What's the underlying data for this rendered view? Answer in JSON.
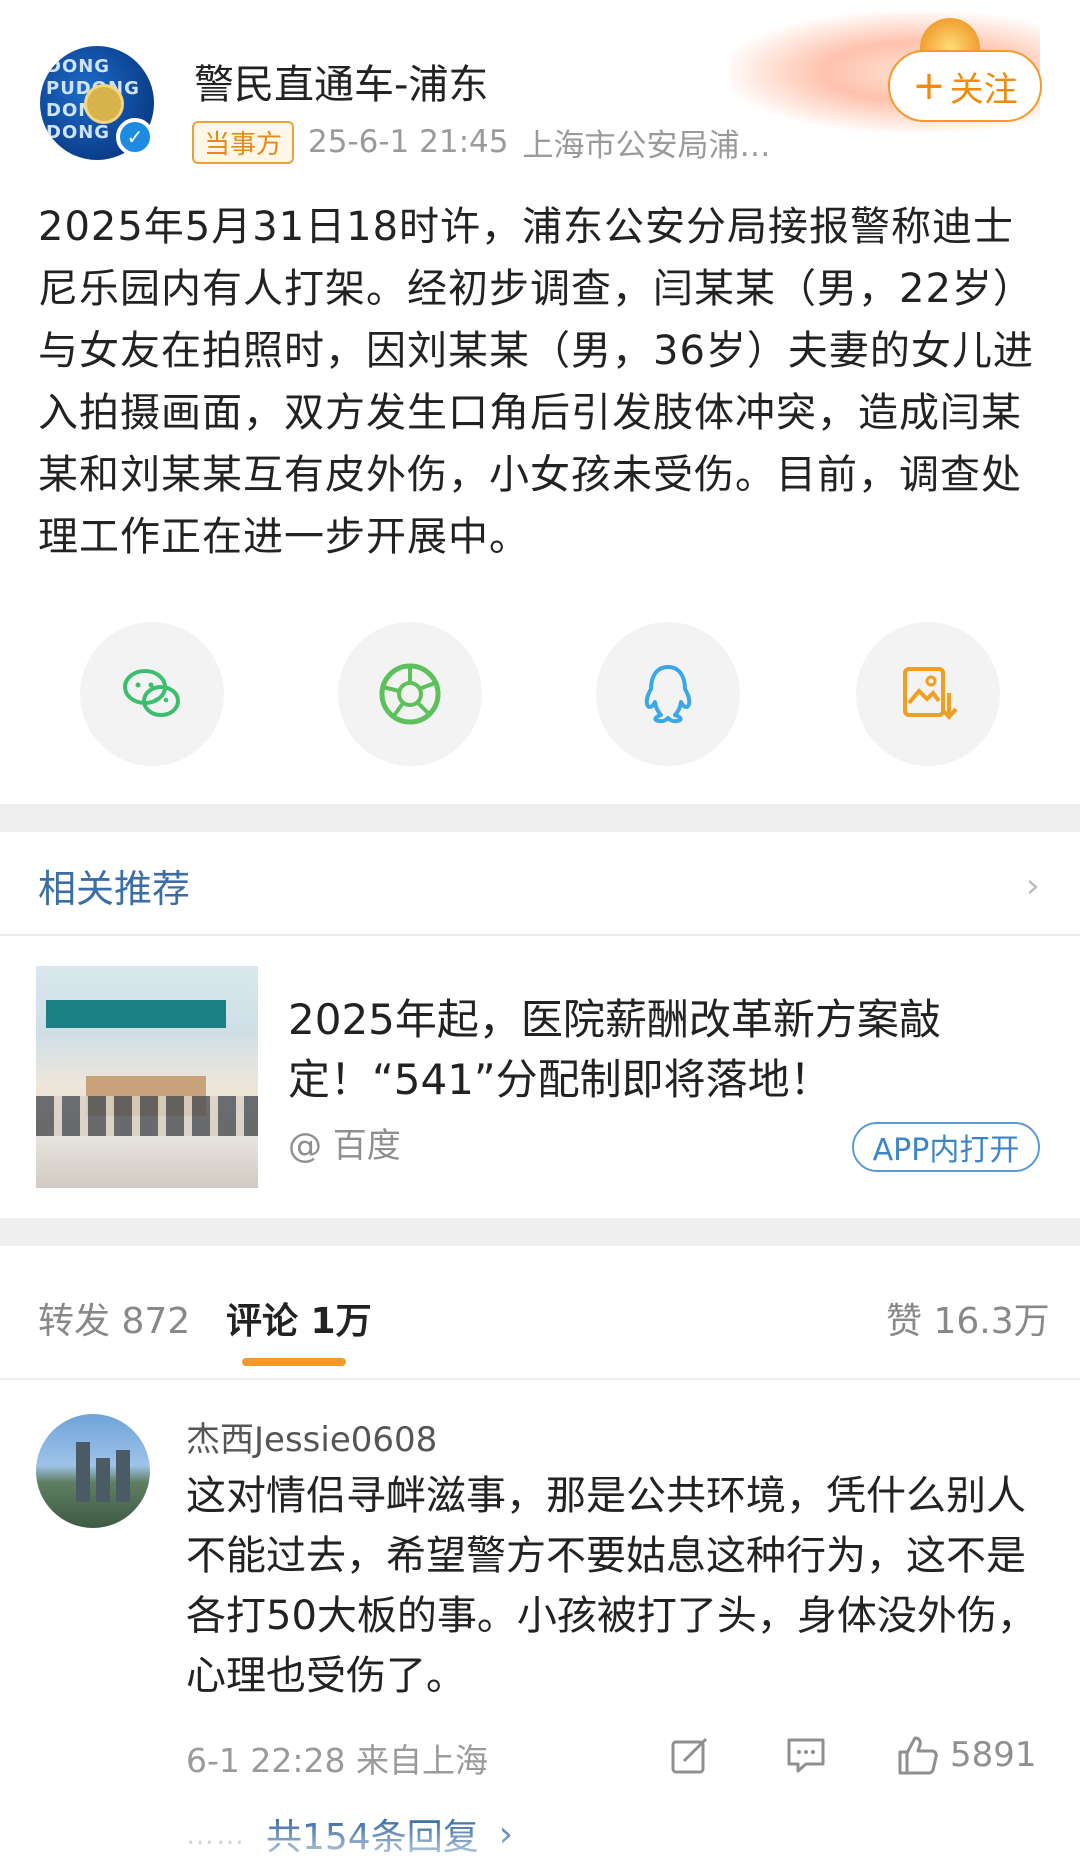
{
  "post": {
    "author_name": "警民直通车-浦东",
    "avatar_text": "DONG PUDONG DONG DONG",
    "tag": "当事方",
    "timestamp": "25-6-1 21:45",
    "source": "上海市公安局浦…",
    "follow_label": "关注",
    "text": "2025年5月31日18时许，浦东公安分局接报警称迪士尼乐园内有人打架。经初步调查，闫某某（男，22岁）与女友在拍照时，因刘某某（男，36岁）夫妻的女儿进入拍摄画面，双方发生口角后引发肢体冲突，造成闫某某和刘某某互有皮外伤，小女孩未受伤。目前，调查处理工作正在进一步开展中。"
  },
  "share": {
    "items": [
      "wechat-icon",
      "moments-icon",
      "qq-icon",
      "save-image-icon"
    ],
    "colors": {
      "wechat": "#3bbf6e",
      "moments": "#5cc15a",
      "qq": "#3aa7e8",
      "save": "#f0a020"
    }
  },
  "related": {
    "title": "相关推荐",
    "card_title": "2025年起，医院薪酬改革新方案敲定！“541”分配制即将落地！",
    "source": "@ 百度",
    "open_label": "APP内打开"
  },
  "tabs": {
    "reposts": "转发 872",
    "comments": "评论 1万",
    "likes": "赞 16.3万"
  },
  "comment": {
    "username": "杰西Jessie0608",
    "text": "这对情侣寻衅滋事，那是公共环境，凭什么别人不能过去，希望警方不要姑息这种行为，这不是各打50大板的事。小孩被打了头，身体没外伤，心理也受伤了。",
    "meta": "6-1 22:28 来自上海",
    "like_count": "5891",
    "replies_label": "共154条回复"
  },
  "colors": {
    "accent_orange": "#f29a2e",
    "link_blue": "#3d6ea6"
  }
}
